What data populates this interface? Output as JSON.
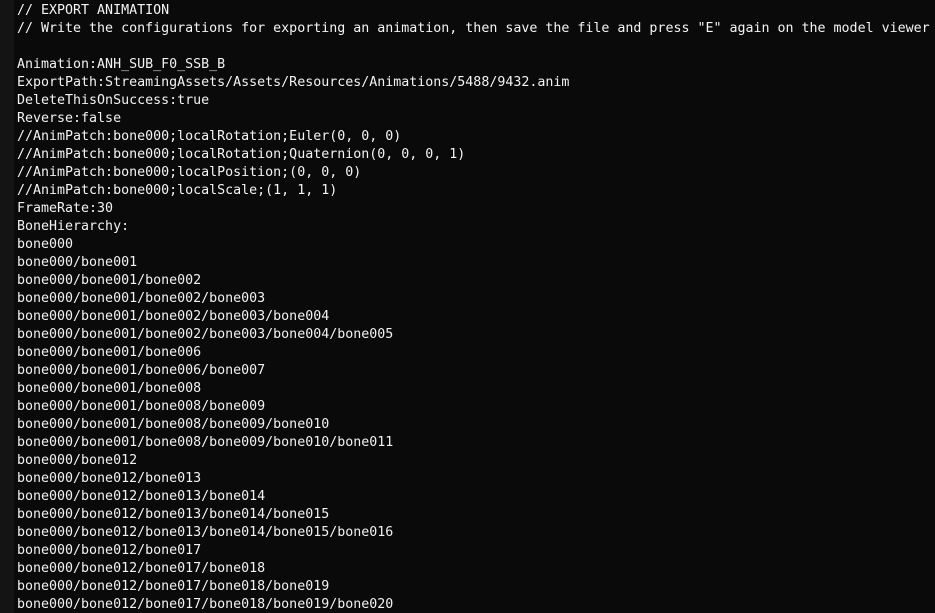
{
  "editor": {
    "background_color": "#0a0a0a",
    "gutter_color": "#141414",
    "text_color": "#f2f2f2",
    "lines": [
      {
        "text": "// EXPORT ANIMATION",
        "kind": "comment"
      },
      {
        "text": "// Write the configurations for exporting an animation, then save the file and press \"E\" again on the model viewer",
        "kind": "comment"
      },
      {
        "text": "",
        "kind": "blank"
      },
      {
        "text": "Animation:ANH_SUB_F0_SSB_B",
        "kind": "config"
      },
      {
        "text": "ExportPath:StreamingAssets/Assets/Resources/Animations/5488/9432.anim",
        "kind": "config"
      },
      {
        "text": "DeleteThisOnSuccess:true",
        "kind": "config"
      },
      {
        "text": "Reverse:false",
        "kind": "config"
      },
      {
        "text": "//AnimPatch:bone000;localRotation;Euler(0, 0, 0)",
        "kind": "comment"
      },
      {
        "text": "//AnimPatch:bone000;localRotation;Quaternion(0, 0, 0, 1)",
        "kind": "comment"
      },
      {
        "text": "//AnimPatch:bone000;localPosition;(0, 0, 0)",
        "kind": "comment"
      },
      {
        "text": "//AnimPatch:bone000;localScale;(1, 1, 1)",
        "kind": "comment"
      },
      {
        "text": "FrameRate:30",
        "kind": "config"
      },
      {
        "text": "BoneHierarchy:",
        "kind": "config"
      },
      {
        "text": "bone000",
        "kind": "bone"
      },
      {
        "text": "bone000/bone001",
        "kind": "bone"
      },
      {
        "text": "bone000/bone001/bone002",
        "kind": "bone"
      },
      {
        "text": "bone000/bone001/bone002/bone003",
        "kind": "bone"
      },
      {
        "text": "bone000/bone001/bone002/bone003/bone004",
        "kind": "bone"
      },
      {
        "text": "bone000/bone001/bone002/bone003/bone004/bone005",
        "kind": "bone"
      },
      {
        "text": "bone000/bone001/bone006",
        "kind": "bone"
      },
      {
        "text": "bone000/bone001/bone006/bone007",
        "kind": "bone"
      },
      {
        "text": "bone000/bone001/bone008",
        "kind": "bone"
      },
      {
        "text": "bone000/bone001/bone008/bone009",
        "kind": "bone"
      },
      {
        "text": "bone000/bone001/bone008/bone009/bone010",
        "kind": "bone"
      },
      {
        "text": "bone000/bone001/bone008/bone009/bone010/bone011",
        "kind": "bone"
      },
      {
        "text": "bone000/bone012",
        "kind": "bone"
      },
      {
        "text": "bone000/bone012/bone013",
        "kind": "bone"
      },
      {
        "text": "bone000/bone012/bone013/bone014",
        "kind": "bone"
      },
      {
        "text": "bone000/bone012/bone013/bone014/bone015",
        "kind": "bone"
      },
      {
        "text": "bone000/bone012/bone013/bone014/bone015/bone016",
        "kind": "bone"
      },
      {
        "text": "bone000/bone012/bone017",
        "kind": "bone"
      },
      {
        "text": "bone000/bone012/bone017/bone018",
        "kind": "bone"
      },
      {
        "text": "bone000/bone012/bone017/bone018/bone019",
        "kind": "bone"
      },
      {
        "text": "bone000/bone012/bone017/bone018/bone019/bone020",
        "kind": "bone"
      }
    ]
  }
}
